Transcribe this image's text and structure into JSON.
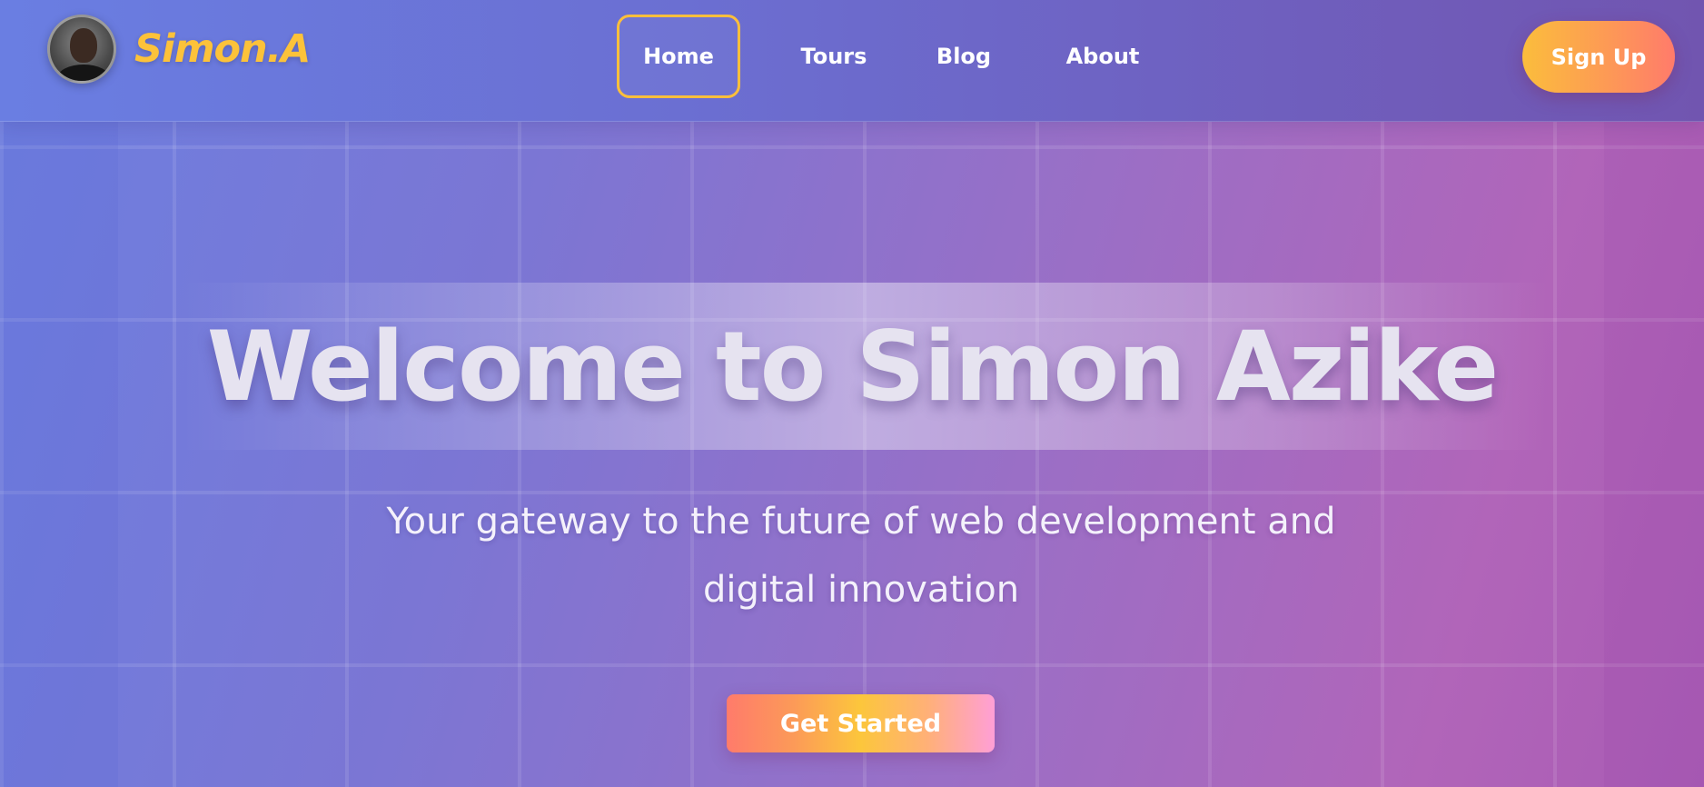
{
  "brand": {
    "name": "Simon.A",
    "avatar_alt": "profile photo"
  },
  "nav": {
    "links": [
      {
        "label": "Home",
        "active": true
      },
      {
        "label": "Tours",
        "active": false
      },
      {
        "label": "Blog",
        "active": false
      },
      {
        "label": "About",
        "active": false
      }
    ],
    "signup_label": "Sign Up"
  },
  "hero": {
    "title": "Welcome to Simon Azike",
    "subtitle": "Your gateway to the future of web development and digital innovation",
    "cta_label": "Get Started"
  },
  "colors": {
    "accent": "#fcc23a",
    "nav_bg": "#6b6fd2",
    "gradient_start": "#6d7fe0",
    "gradient_end": "#b165b9"
  }
}
